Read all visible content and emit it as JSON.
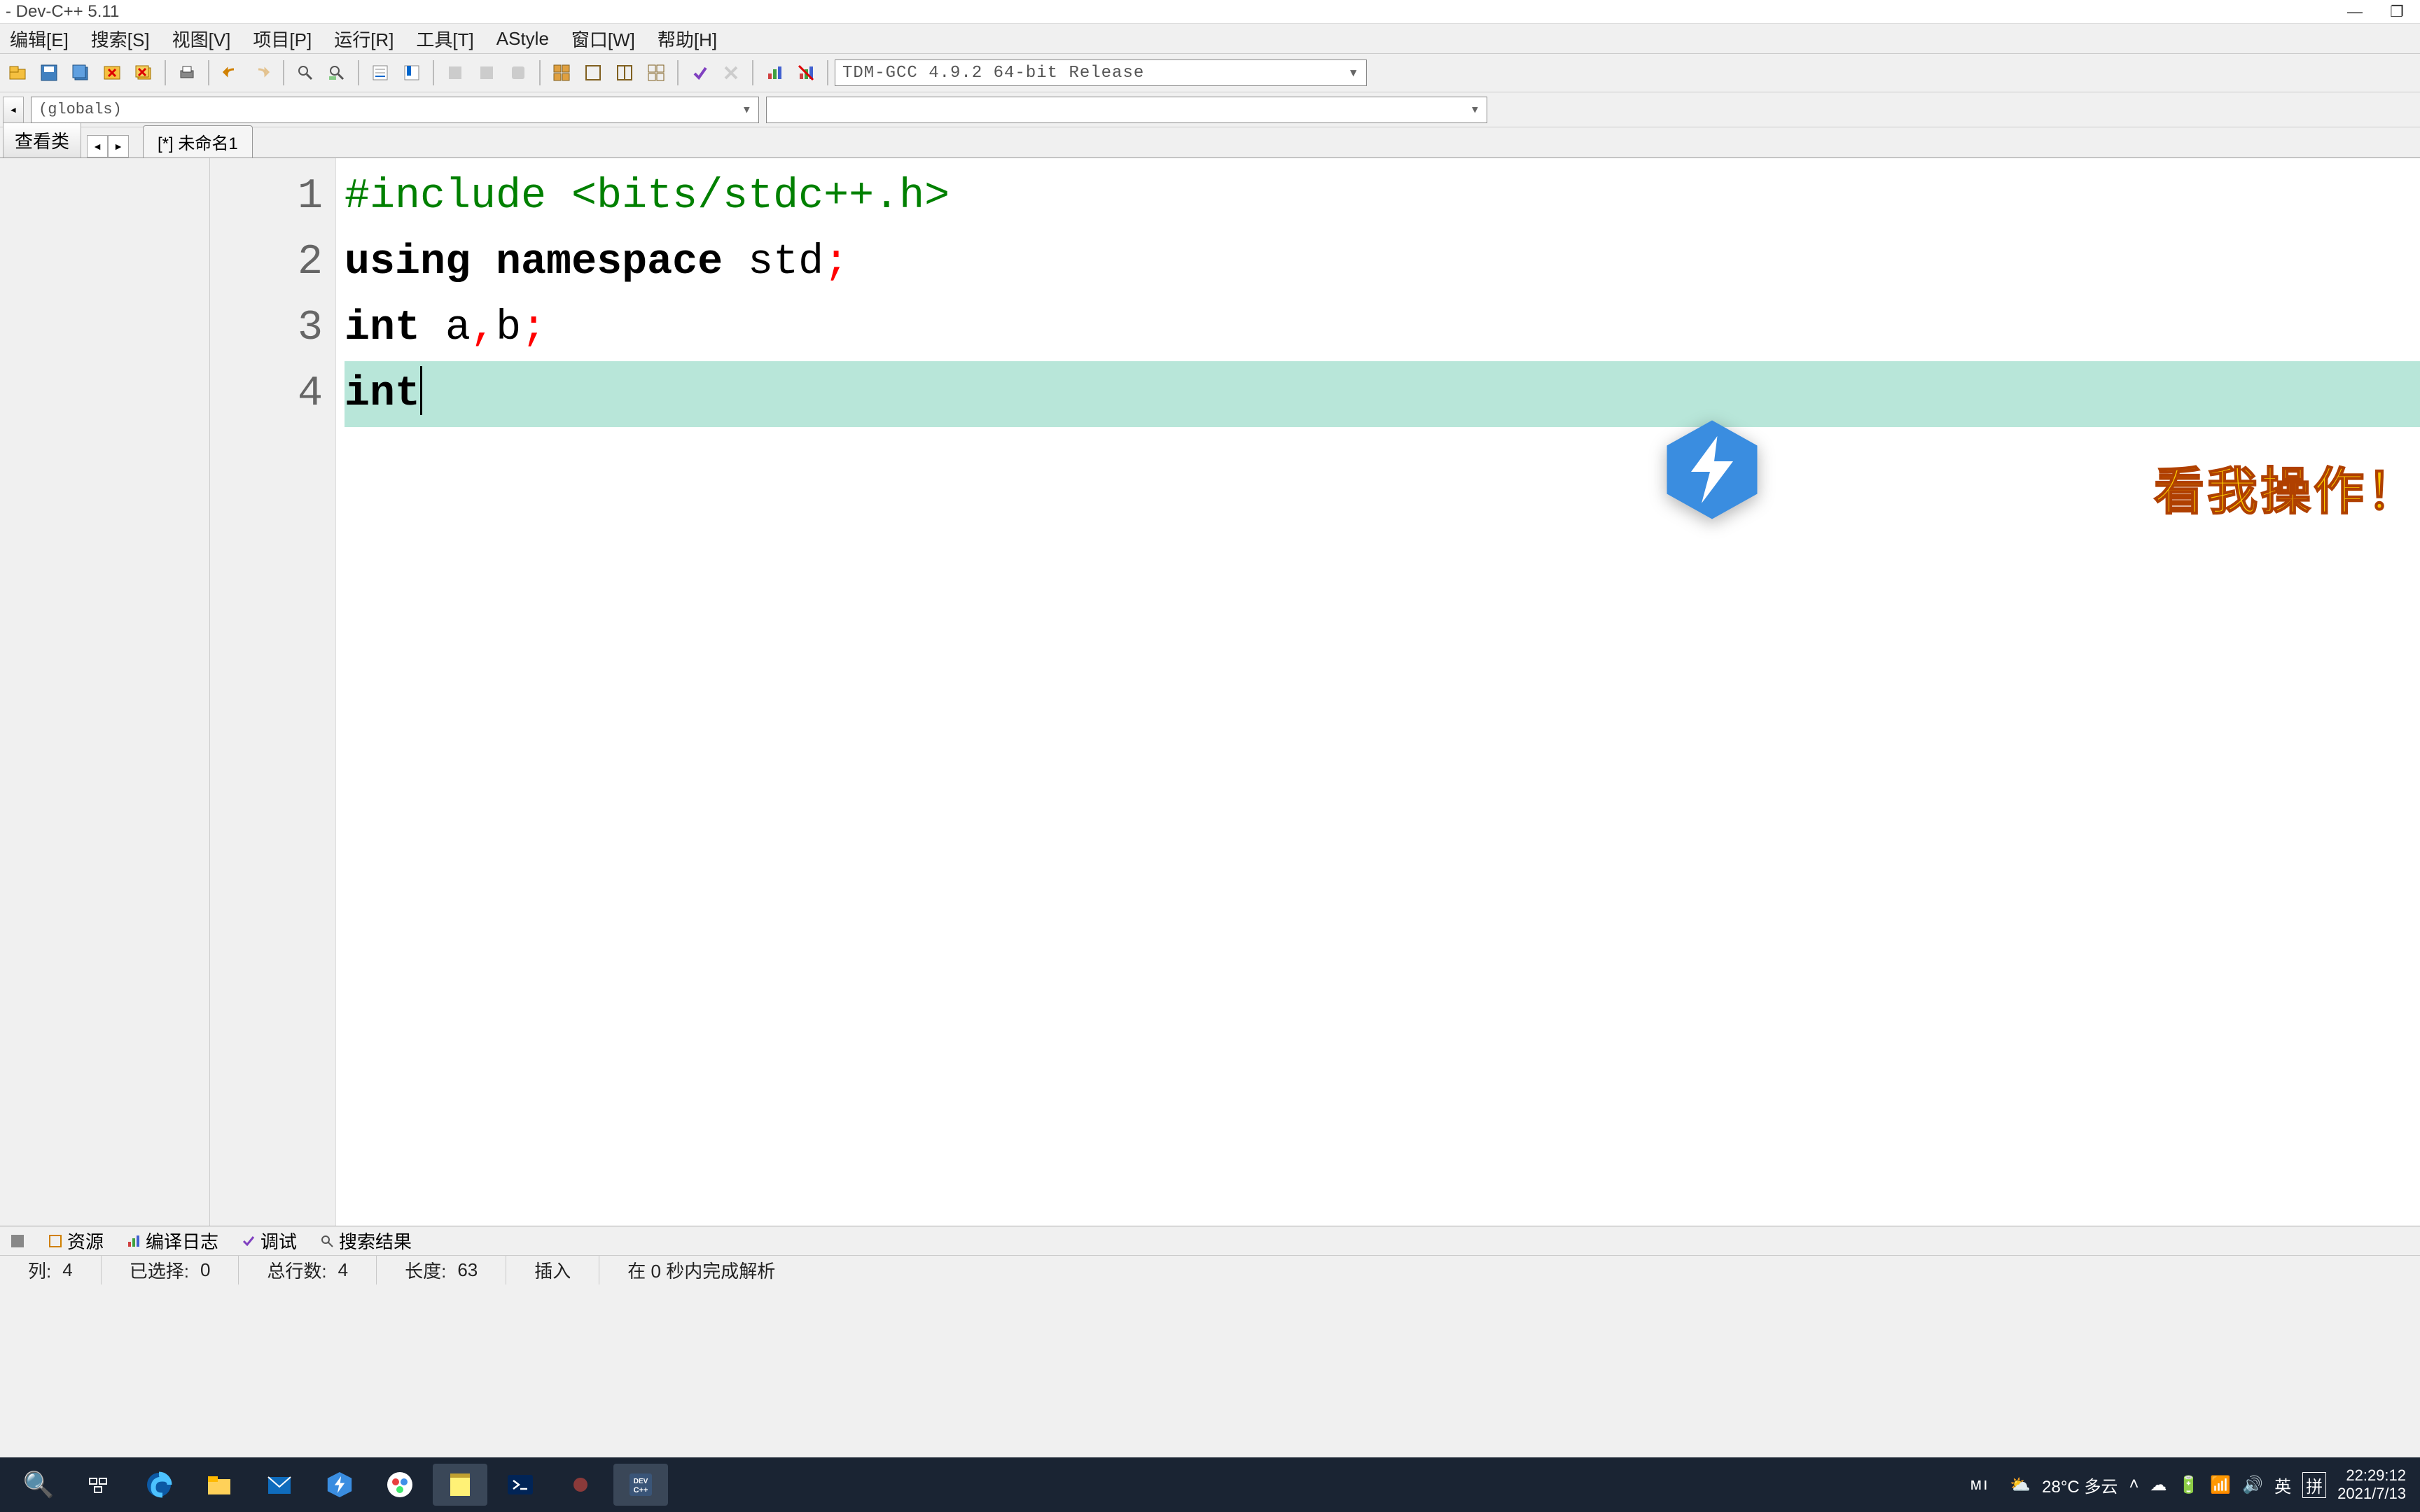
{
  "title": "- Dev-C++ 5.11",
  "menu": {
    "edit": "编辑[E]",
    "search": "搜索[S]",
    "view": "视图[V]",
    "project": "项目[P]",
    "run": "运行[R]",
    "tools": "工具[T]",
    "astyle": "AStyle",
    "window": "窗口[W]",
    "help": "帮助[H]"
  },
  "compiler": "TDM-GCC 4.9.2 64-bit Release",
  "globals": "(globals)",
  "class_view": "查看类",
  "file_tab": "[*] 未命名1",
  "code": {
    "line1": "#include <bits/stdc++.h>",
    "line2_using": "using",
    "line2_ns": "namespace",
    "line2_std": " std",
    "line2_semi": ";",
    "line3_int": "int",
    "line3_rest": " a",
    "line3_comma": ",",
    "line3_b": "b",
    "line3_semi": ";",
    "line4": "int",
    "ln1": "1",
    "ln2": "2",
    "ln3": "3",
    "ln4": "4"
  },
  "overlay": "看我操作！",
  "bottom": {
    "resource": "资源",
    "compilelog": "编译日志",
    "debug": "调试",
    "searchres": "搜索结果"
  },
  "status": {
    "col_label": "列:",
    "col": "4",
    "sel_label": "已选择:",
    "sel": "0",
    "lines_label": "总行数:",
    "lines": "4",
    "len_label": "长度:",
    "len": "63",
    "mode": "插入",
    "parse": "在 0 秒内完成解析"
  },
  "tray": {
    "weather": "28°C 多云",
    "ime": "英",
    "ime2": "拼",
    "time": "22:29:12",
    "date": "2021/7/13"
  }
}
